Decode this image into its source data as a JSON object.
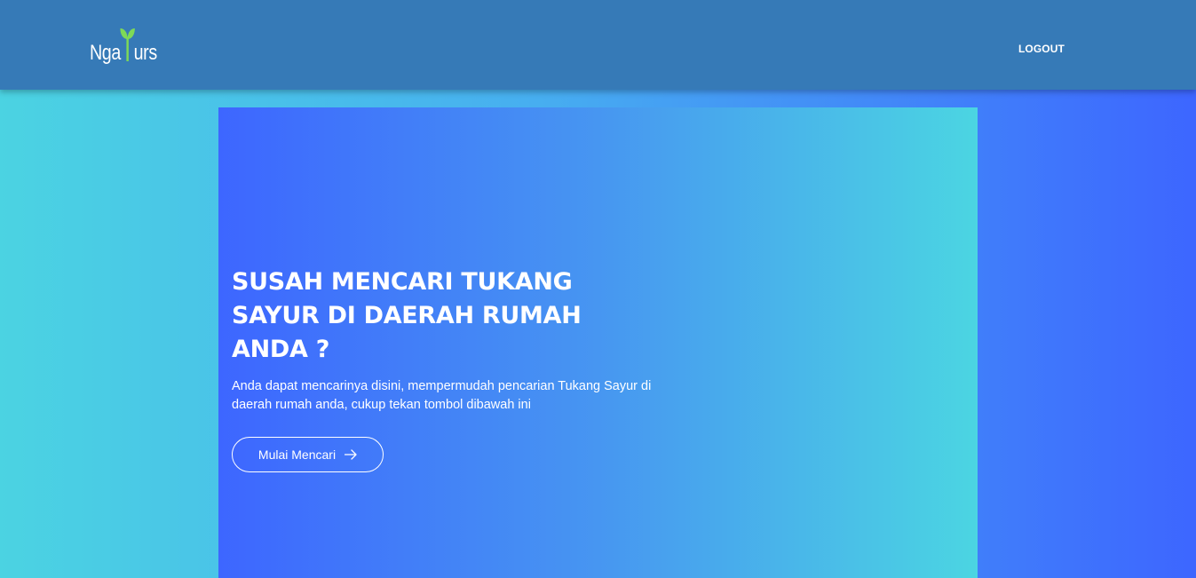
{
  "header": {
    "logo": {
      "part1": "Nga",
      "part2": "urs",
      "icon": "sprout-icon"
    },
    "logout_label": "LOGOUT"
  },
  "hero": {
    "title": "SUSAH MENCARI TUKANG SAYUR DI DAERAH RUMAH ANDA ?",
    "description": "Anda dapat mencarinya disini, mempermudah pencarian Tukang Sayur di daerah rumah anda, cukup tekan tombol dibawah ini",
    "cta_label": "Mulai Mencari",
    "cta_icon": "arrow-right-icon"
  },
  "colors": {
    "navbar": "#367ab7",
    "accent_green": "#7ed957",
    "text": "#ffffff"
  }
}
